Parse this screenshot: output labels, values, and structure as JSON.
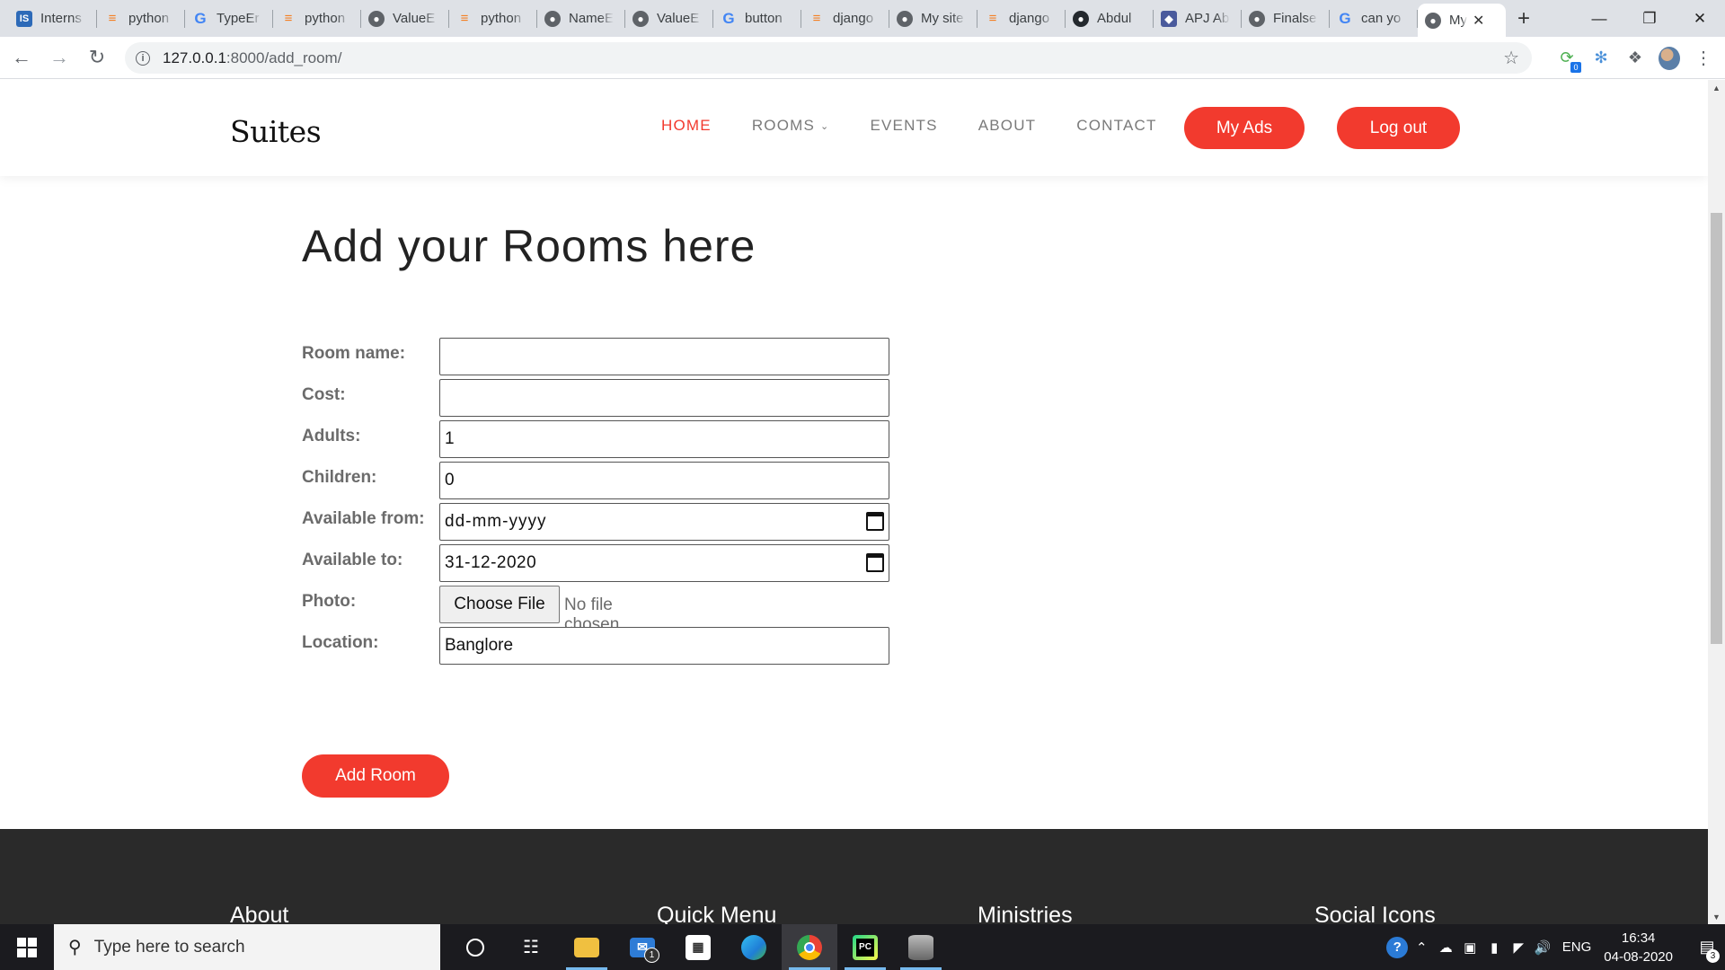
{
  "browser": {
    "tabs": [
      {
        "title": "Interns",
        "icon": "is-icon"
      },
      {
        "title": "python",
        "icon": "stackoverflow-icon"
      },
      {
        "title": "TypeEr",
        "icon": "google-icon"
      },
      {
        "title": "python",
        "icon": "stackoverflow-icon"
      },
      {
        "title": "ValueE",
        "icon": "globe-icon"
      },
      {
        "title": "python",
        "icon": "stackoverflow-icon"
      },
      {
        "title": "NameE",
        "icon": "globe-icon"
      },
      {
        "title": "ValueE",
        "icon": "globe-icon"
      },
      {
        "title": "button",
        "icon": "google-icon"
      },
      {
        "title": "django",
        "icon": "stackoverflow-icon"
      },
      {
        "title": "My site",
        "icon": "globe-icon"
      },
      {
        "title": "django",
        "icon": "stackoverflow-icon"
      },
      {
        "title": "Abdul",
        "icon": "github-icon"
      },
      {
        "title": "APJ Ab",
        "icon": "shield-icon"
      },
      {
        "title": "Finalse",
        "icon": "globe-icon"
      },
      {
        "title": "can yo",
        "icon": "google-icon"
      }
    ],
    "active_tab": {
      "title": "My",
      "icon": "globe-icon"
    },
    "url_host": "127.0.0.1",
    "url_rest": ":8000/add_room/",
    "extension_badge": "0"
  },
  "site": {
    "logo": "Suites",
    "nav": {
      "home": "HOME",
      "rooms": "ROOMS",
      "events": "EVENTS",
      "about": "ABOUT",
      "contact": "CONTACT"
    },
    "my_ads": "My Ads",
    "log_out": "Log out",
    "accent_color": "#f23a2e"
  },
  "page": {
    "title": "Add your Rooms here",
    "form": {
      "room_name_label": "Room name:",
      "room_name_value": "",
      "cost_label": "Cost:",
      "cost_value": "",
      "adults_label": "Adults:",
      "adults_value": "1",
      "children_label": "Children:",
      "children_value": "0",
      "available_from_label": "Available from:",
      "available_from_value": "dd-mm-yyyy",
      "available_to_label": "Available to:",
      "available_to_value": "31-12-2020",
      "photo_label": "Photo:",
      "choose_file": "Choose File",
      "no_file": "No file chosen",
      "location_label": "Location:",
      "location_value": "Banglore",
      "submit": "Add Room"
    }
  },
  "footer": {
    "about": "About",
    "quick_menu": "Quick Menu",
    "ministries": "Ministries",
    "social_icons": "Social Icons"
  },
  "taskbar": {
    "search_placeholder": "Type here to search",
    "mail_badge": "1",
    "language": "ENG",
    "time": "16:34",
    "date": "04-08-2020",
    "notifications": "3"
  }
}
